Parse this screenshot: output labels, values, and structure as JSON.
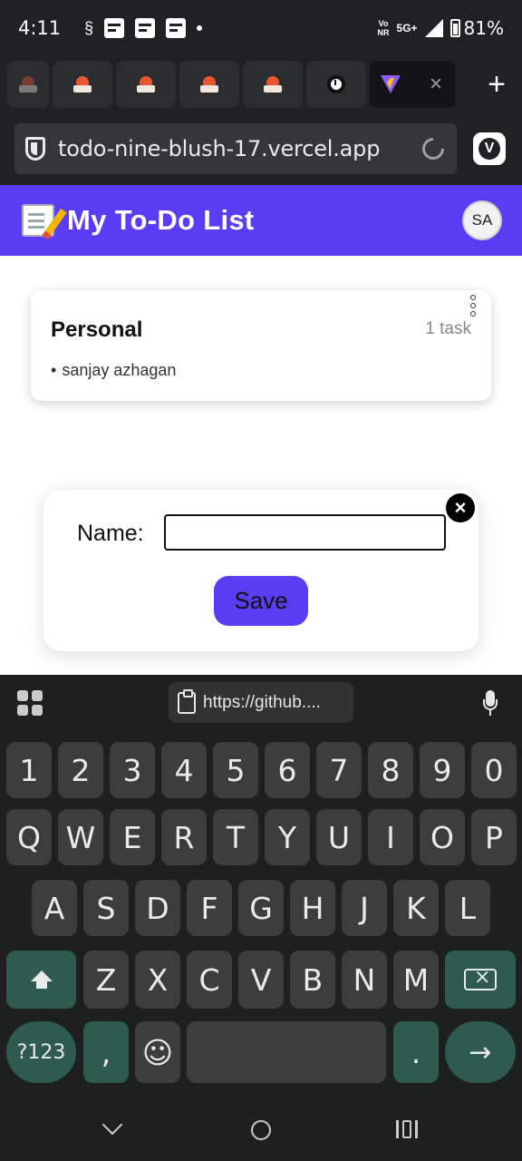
{
  "status_bar": {
    "time": "4:11",
    "volte_top": "Vo",
    "volte_bottom": "NR",
    "network": "5G+",
    "battery": "81%"
  },
  "browser": {
    "active_tab_close": "×",
    "new_tab": "+",
    "url": "todo-nine-blush-17.vercel.app"
  },
  "app": {
    "title": "My To-Do List",
    "avatar_initials": "SA"
  },
  "lists": [
    {
      "title": "Personal",
      "task_count": "1 task",
      "tasks": [
        "sanjay azhagan"
      ]
    }
  ],
  "modal": {
    "close_label": "×",
    "name_label": "Name:",
    "name_value": "",
    "save_label": "Save"
  },
  "keyboard": {
    "clipboard_chip": "https://github....",
    "row_numbers": [
      "1",
      "2",
      "3",
      "4",
      "5",
      "6",
      "7",
      "8",
      "9",
      "0"
    ],
    "row1": [
      "Q",
      "W",
      "E",
      "R",
      "T",
      "Y",
      "U",
      "I",
      "O",
      "P"
    ],
    "row2": [
      "A",
      "S",
      "D",
      "F",
      "G",
      "H",
      "J",
      "K",
      "L"
    ],
    "row3": [
      "Z",
      "X",
      "C",
      "V",
      "B",
      "N",
      "M"
    ],
    "symbols_label": "?123",
    "comma": ",",
    "emoji": "☺",
    "period": ".",
    "enter": "→"
  },
  "colors": {
    "brand": "#5b3cf5",
    "browser_chrome": "#202124",
    "keyboard_bg": "#1d201f",
    "keyboard_accent": "#2e5a4f"
  }
}
